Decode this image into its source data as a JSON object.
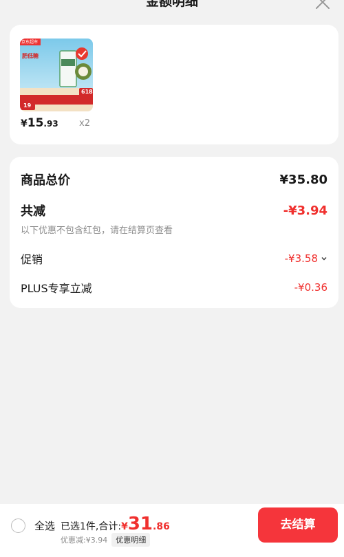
{
  "header": {
    "title": "金额明细"
  },
  "product": {
    "price_yen": "¥",
    "price_int": "15",
    "price_dec": ".93",
    "quantity": "x2",
    "thumb": {
      "brand": "京东超市",
      "promo": "肥低糖",
      "tag": "618",
      "price_tag": "19"
    }
  },
  "summary": {
    "total_label": "商品总价",
    "total_value": "¥35.80",
    "reduce_label": "共减",
    "reduce_value": "-¥3.94",
    "note": "以下优惠不包含红包，请在结算页查看",
    "promo_label": "促销",
    "promo_value": "-¥3.58",
    "plus_label": "PLUS专享立减",
    "plus_value": "-¥0.36"
  },
  "bottom": {
    "select_all": "全选",
    "selected_text": "已选1件,合计:",
    "total_yen": "¥",
    "total_int": "31",
    "total_dec": ".86",
    "discount_text": "优惠减:¥3.94",
    "discount_chip": "优惠明细",
    "checkout": "去结算"
  },
  "colors": {
    "accent_red": "#f0302e",
    "checkout_bg": "#f5353b",
    "bg": "#f2f2f2"
  }
}
